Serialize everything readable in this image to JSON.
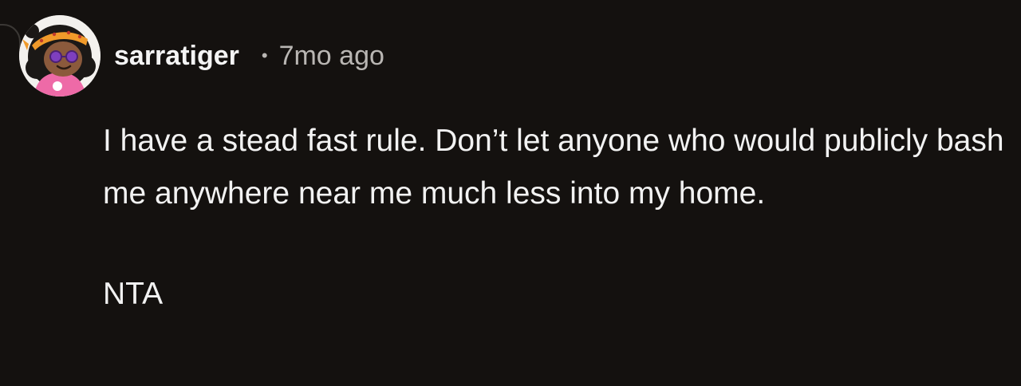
{
  "comment": {
    "username": "sarratiger",
    "separator": "•",
    "timestamp": "7mo ago",
    "paragraphs": [
      "I have a stead fast rule. Don’t let anyone who would publicly bash me anywhere near me much less into my home.",
      "NTA"
    ]
  }
}
